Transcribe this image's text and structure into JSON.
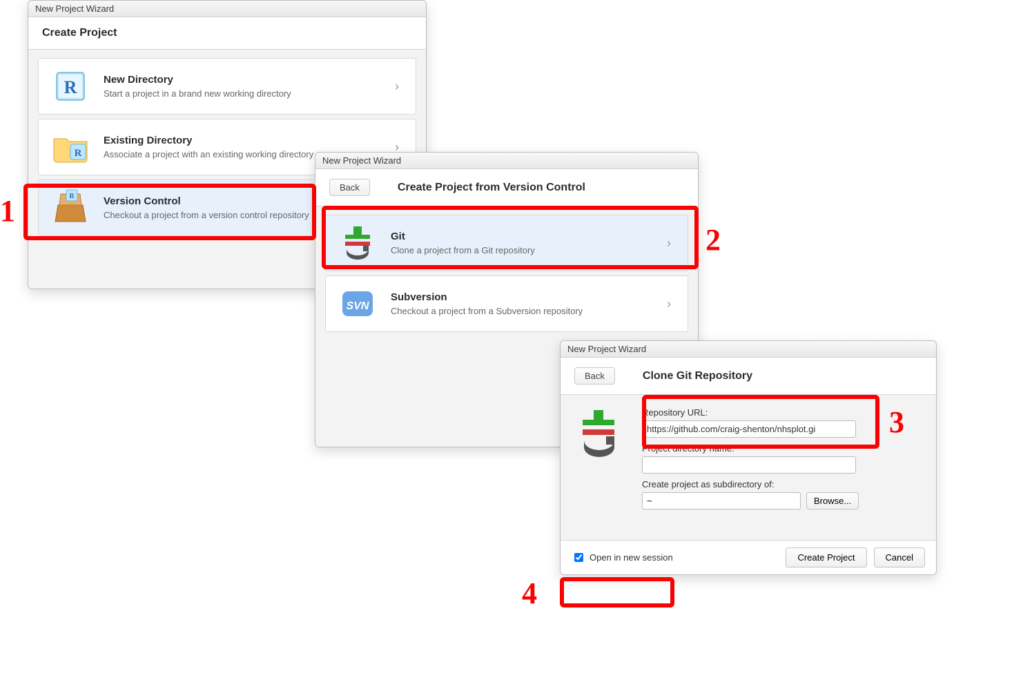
{
  "window1": {
    "title": "New Project Wizard",
    "header": "Create Project",
    "options": [
      {
        "title": "New Directory",
        "subtitle": "Start a project in a brand new working directory"
      },
      {
        "title": "Existing Directory",
        "subtitle": "Associate a project with an existing working directory"
      },
      {
        "title": "Version Control",
        "subtitle": "Checkout a project from a version control repository"
      }
    ]
  },
  "window2": {
    "title": "New Project Wizard",
    "back": "Back",
    "header": "Create Project from Version Control",
    "options": [
      {
        "title": "Git",
        "subtitle": "Clone a project from a Git repository"
      },
      {
        "title": "Subversion",
        "subtitle": "Checkout a project from a Subversion repository"
      }
    ]
  },
  "window3": {
    "title": "New Project Wizard",
    "back": "Back",
    "header": "Clone Git Repository",
    "repo_url_label": "Repository URL:",
    "repo_url_value": "https://github.com/craig-shenton/nhsplot.gi",
    "dir_name_label": "Project directory name:",
    "dir_name_value": "",
    "subdir_label": "Create project as subdirectory of:",
    "subdir_value": "~",
    "browse": "Browse...",
    "open_new_session": "Open in new session",
    "create_project": "Create Project",
    "cancel": "Cancel"
  },
  "annotations": {
    "n1": "1",
    "n2": "2",
    "n3": "3",
    "n4": "4"
  }
}
